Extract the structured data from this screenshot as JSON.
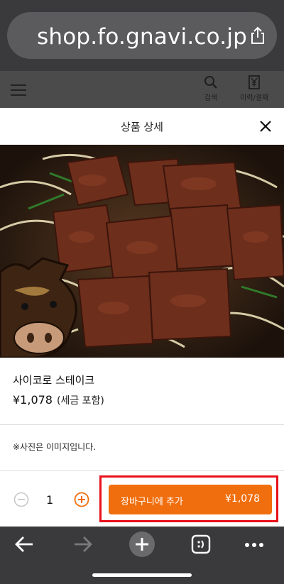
{
  "browser": {
    "url": "shop.fo.gnavi.co.jp"
  },
  "site_header": {
    "search_label": "검색",
    "history_label": "이력/결재"
  },
  "modal": {
    "title": "상품 상세",
    "product": {
      "name": "사이코로 스테이크",
      "price": "¥1,078",
      "tax_note": "(세금 포함)"
    },
    "photo_note": "※사진은 이미지입니다.",
    "quantity": "1",
    "cart_button": {
      "label": "장바구니에 추가",
      "amount": "¥1,078"
    }
  },
  "colors": {
    "accent": "#f06e0d",
    "highlight": "#e8101a"
  }
}
